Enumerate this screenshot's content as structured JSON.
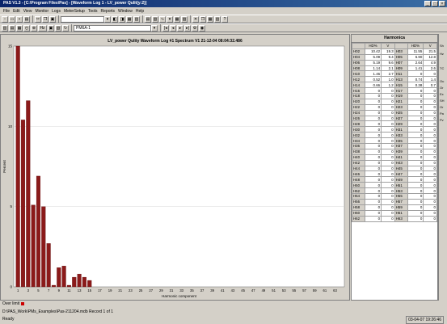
{
  "window": {
    "title": "PAS V1.3 - [C:\\Program Files\\Pas] - [Waveform Log 1 - LV_power Qulit(y:2)]"
  },
  "menu": [
    "File",
    "Edit",
    "View",
    "Monitor",
    "Logs",
    "MeterSetup",
    "Tools",
    "Reports",
    "Window",
    "Help"
  ],
  "toolbar": {
    "site_select": "",
    "channel_select": "PM6A-1",
    "hz_label": "Hz"
  },
  "chart": {
    "title": "LV_power Qulity  Waveform Log #1  Spectrum V1  21-12-04  08:04:32.486",
    "ylabel": "Percent",
    "xlabel": "Harmonic component",
    "yticks": [
      "0",
      "5",
      "10",
      "15"
    ],
    "xticks": [
      "1",
      "3",
      "5",
      "7",
      "9",
      "11",
      "13",
      "15",
      "17",
      "19",
      "21",
      "23",
      "25",
      "27",
      "29",
      "31",
      "33",
      "35",
      "37",
      "39",
      "41",
      "43",
      "45",
      "47",
      "49",
      "51",
      "53",
      "55",
      "57",
      "59",
      "61",
      "63"
    ],
    "legend_label": "Over limit"
  },
  "chart_data": {
    "type": "bar",
    "title": "LV_power Qulity  Waveform Log #1  Spectrum V1  21-12-04  08:04:32.486",
    "xlabel": "Harmonic component",
    "ylabel": "Percent",
    "ylim": [
      0,
      15
    ],
    "categories": [
      1,
      2,
      3,
      4,
      5,
      6,
      7,
      8,
      9,
      10,
      11,
      12,
      13,
      14,
      15,
      16
    ],
    "values": [
      15,
      10.4,
      11.6,
      5.1,
      6.9,
      5.0,
      2.7,
      0.1,
      1.2,
      1.3,
      0.1,
      0.6,
      0.8,
      0.6,
      0.4,
      0
    ],
    "grid": true
  },
  "harmonics": {
    "title": "Harmonica",
    "columns": [
      "",
      "HD%",
      "V",
      "",
      "HD%",
      "V"
    ],
    "rows": [
      [
        "H02",
        "10.42",
        "19.3",
        "H03",
        "11.55",
        "21.5"
      ],
      [
        "H04",
        "5.09",
        "9.4",
        "H05",
        "6.90",
        "12.8"
      ],
      [
        "H06",
        "5.19",
        "9.6",
        "H07",
        "2.64",
        "4.9"
      ],
      [
        "H08",
        "1.14",
        "2.1",
        "H09",
        "1.41",
        "2.6"
      ],
      [
        "H10",
        "1.46",
        "2.7",
        "H11",
        "0",
        "0"
      ],
      [
        "H12",
        "0.52",
        "1.0",
        "H13",
        "0.74",
        "1.4"
      ],
      [
        "H14",
        "0.66",
        "1.2",
        "H15",
        "0.38",
        "0.7"
      ],
      [
        "H16",
        "0",
        "0",
        "H17",
        "0",
        "0"
      ],
      [
        "H18",
        "0",
        "0",
        "H19",
        "0",
        "0"
      ],
      [
        "H20",
        "0",
        "0",
        "H21",
        "0",
        "0"
      ],
      [
        "H22",
        "0",
        "0",
        "H23",
        "0",
        "0"
      ],
      [
        "H24",
        "0",
        "0",
        "H25",
        "0",
        "0"
      ],
      [
        "H26",
        "0",
        "0",
        "H27",
        "0",
        "0"
      ],
      [
        "H28",
        "0",
        "0",
        "H29",
        "0",
        "0"
      ],
      [
        "H30",
        "0",
        "0",
        "H31",
        "0",
        "0"
      ],
      [
        "H32",
        "0",
        "0",
        "H33",
        "0",
        "0"
      ],
      [
        "H34",
        "0",
        "0",
        "H35",
        "0",
        "0"
      ],
      [
        "H36",
        "0",
        "0",
        "H37",
        "0",
        "0"
      ],
      [
        "H38",
        "0",
        "0",
        "H39",
        "0",
        "0"
      ],
      [
        "H40",
        "0",
        "0",
        "H41",
        "0",
        "0"
      ],
      [
        "H42",
        "0",
        "0",
        "H43",
        "0",
        "0"
      ],
      [
        "H44",
        "0",
        "0",
        "H45",
        "0",
        "0"
      ],
      [
        "H46",
        "0",
        "0",
        "H47",
        "0",
        "0"
      ],
      [
        "H48",
        "0",
        "0",
        "H49",
        "0",
        "0"
      ],
      [
        "H50",
        "0",
        "0",
        "H51",
        "0",
        "0"
      ],
      [
        "H52",
        "0",
        "0",
        "H53",
        "0",
        "0"
      ],
      [
        "H54",
        "0",
        "0",
        "H55",
        "0",
        "0"
      ],
      [
        "H56",
        "0",
        "0",
        "H57",
        "0",
        "0"
      ],
      [
        "H58",
        "0",
        "0",
        "H59",
        "0",
        "0"
      ],
      [
        "H60",
        "0",
        "0",
        "H61",
        "0",
        "0"
      ],
      [
        "H62",
        "0",
        "0",
        "H63",
        "0",
        "0"
      ]
    ]
  },
  "side": [
    "Sh",
    "Hz",
    "TC",
    "Ou",
    "Or",
    "Ex",
    "SH",
    "Or",
    "Pa",
    "Pv"
  ],
  "status": {
    "path": "D:\\PAS_Work\\PMs_Examples\\Pas-211204.mdb  Record 1 of 1",
    "ready": "Ready",
    "datetime": "03-04-07 19:26:46"
  },
  "colors": {
    "bar": "#8b1a1a",
    "overlimit": "#cc0000",
    "titlebar": "#0a246a"
  }
}
